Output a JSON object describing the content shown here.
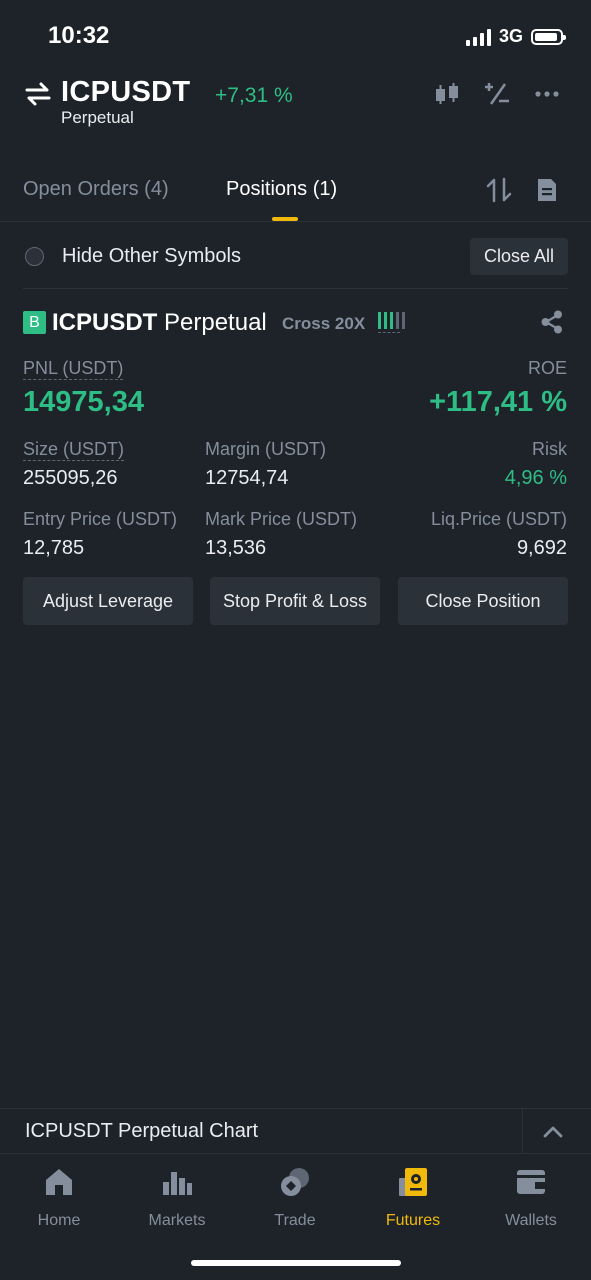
{
  "status_bar": {
    "time": "10:32",
    "network": "3G"
  },
  "header": {
    "symbol": "ICPUSDT",
    "contract_type": "Perpetual",
    "change": "+7,31 %",
    "icons": [
      "swap-icon",
      "candlestick-icon",
      "percent-icon",
      "more-icon"
    ]
  },
  "tabs": {
    "open_orders": "Open Orders (4)",
    "positions": "Positions (1)",
    "active": "positions",
    "icons": [
      "sort-icon",
      "document-icon"
    ]
  },
  "filter": {
    "hide_other_symbols": "Hide Other Symbols",
    "hide_other_symbols_checked": false,
    "close_all": "Close All"
  },
  "position": {
    "side_badge": "B",
    "symbol": "ICPUSDT",
    "contract": "Perpetual",
    "margin_mode": "Cross 20X",
    "pnl_label": "PNL (USDT)",
    "pnl_value": "14975,34",
    "roe_label": "ROE",
    "roe_value": "+117,41 %",
    "size_label": "Size (USDT)",
    "size_value": "255095,26",
    "margin_label": "Margin (USDT)",
    "margin_value": "12754,74",
    "risk_label": "Risk",
    "risk_value": "4,96 %",
    "entry_label": "Entry Price (USDT)",
    "entry_value": "12,785",
    "mark_label": "Mark Price (USDT)",
    "mark_value": "13,536",
    "liq_label": "Liq.Price (USDT)",
    "liq_value": "9,692",
    "buttons": {
      "adjust_leverage": "Adjust Leverage",
      "stop_profit_loss": "Stop Profit & Loss",
      "close_position": "Close Position"
    }
  },
  "chart_bar": {
    "label": "ICPUSDT Perpetual Chart"
  },
  "nav": {
    "items": [
      {
        "label": "Home",
        "icon": "home-icon"
      },
      {
        "label": "Markets",
        "icon": "markets-icon"
      },
      {
        "label": "Trade",
        "icon": "trade-icon"
      },
      {
        "label": "Futures",
        "icon": "futures-icon"
      },
      {
        "label": "Wallets",
        "icon": "wallet-icon"
      }
    ],
    "active": "Futures"
  },
  "colors": {
    "background": "#1e2329",
    "surface": "#2b3139",
    "positive": "#2ebd85",
    "accent": "#f0b90b",
    "muted": "#848e9c"
  }
}
